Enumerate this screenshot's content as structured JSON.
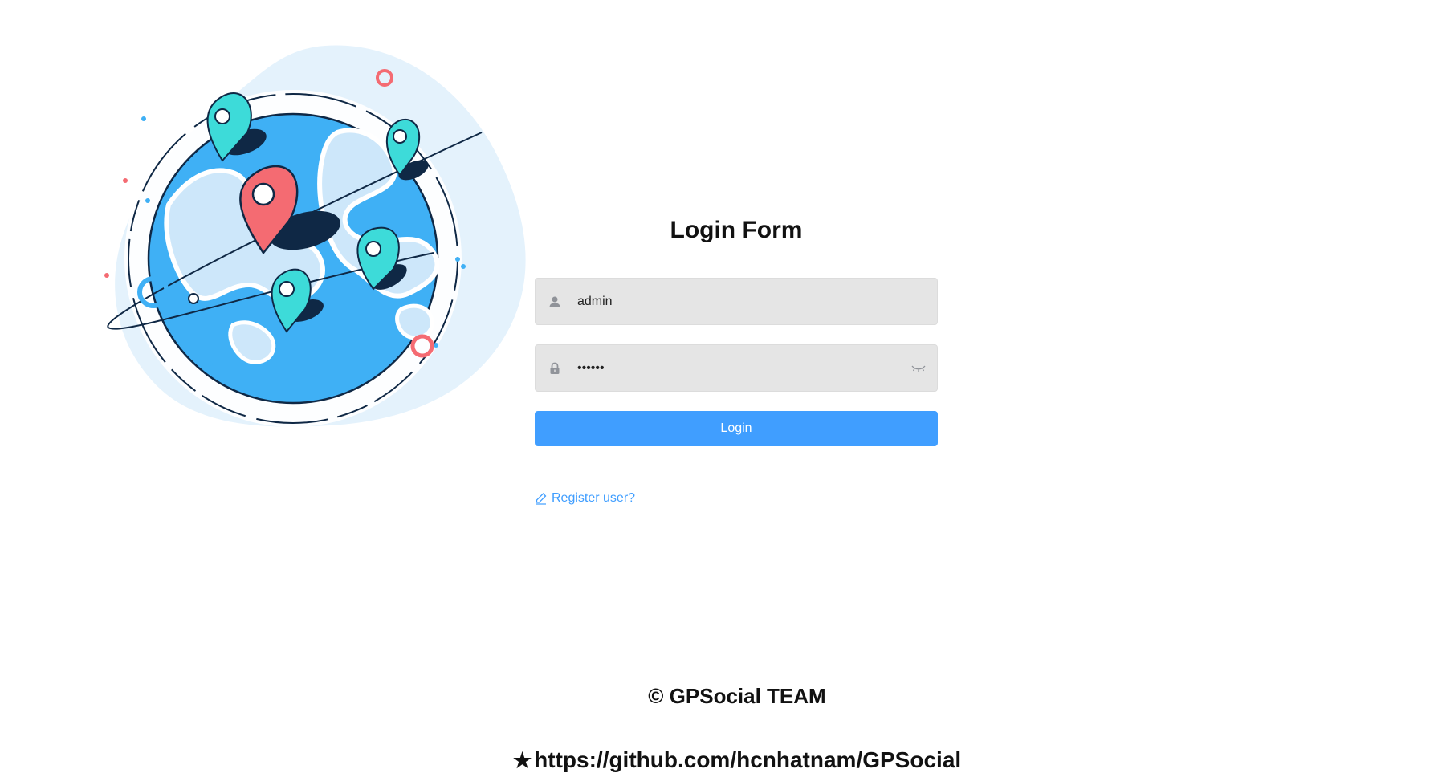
{
  "form": {
    "title": "Login Form",
    "username": {
      "value": "admin",
      "icon": "user-icon"
    },
    "password": {
      "value": "••••••",
      "icon": "lock-icon",
      "toggle_icon": "eye-closed-icon"
    },
    "login_label": "Login",
    "register_label": "Register user?",
    "register_icon": "edit-icon"
  },
  "footer": {
    "team": "© GPSocial TEAM",
    "link_icon": "star-icon",
    "link": "https://github.com/hcnhatnam/GPSocial"
  },
  "colors": {
    "accent": "#409eff",
    "input_bg": "#e5e5e5",
    "globe_blue": "#3fb0f5",
    "pin_teal": "#3ddbd9",
    "pin_red": "#f46b72",
    "navy": "#0f2845"
  }
}
